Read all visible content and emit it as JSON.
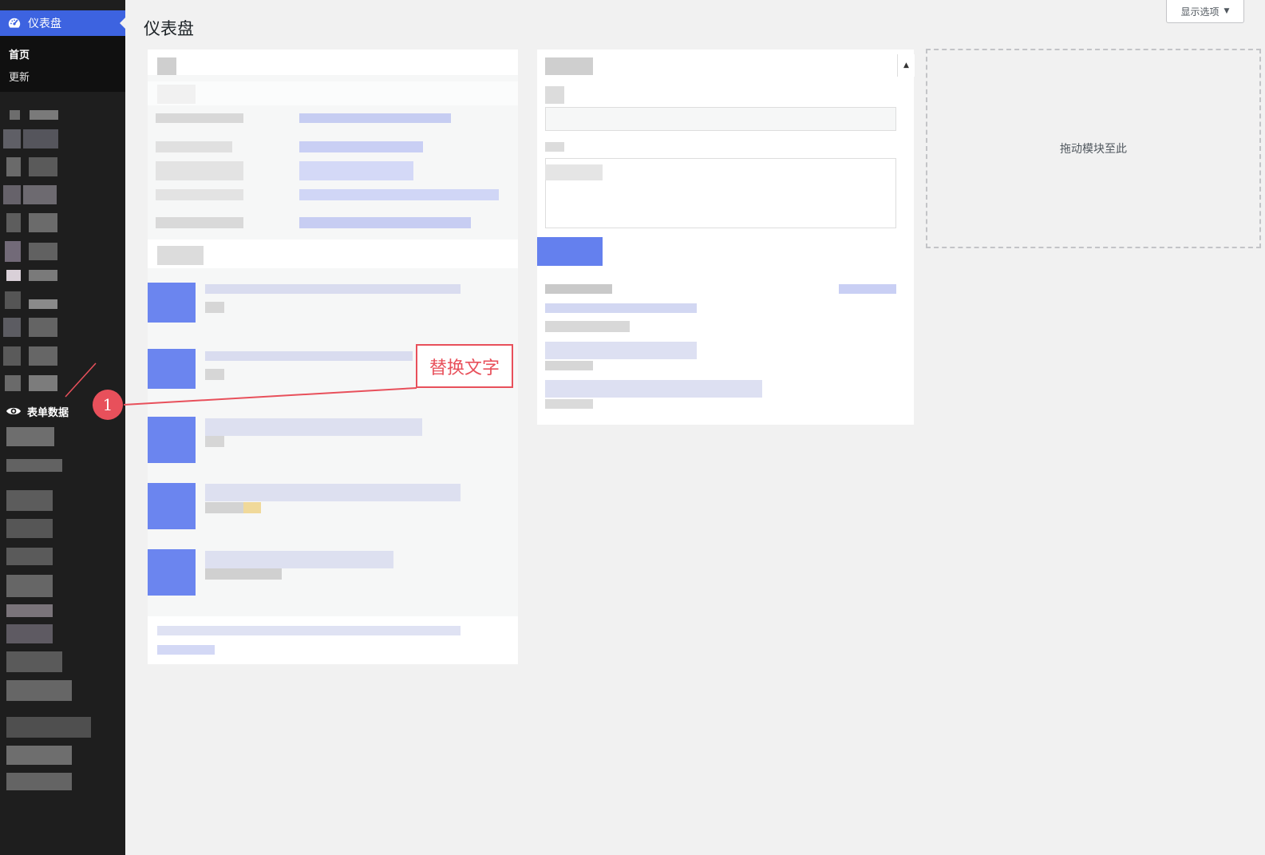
{
  "sidebar": {
    "active_menu": "仪表盘",
    "submenu": [
      "首页",
      "更新"
    ],
    "forms_menu": "表单数据"
  },
  "page": {
    "title": "仪表盘",
    "screen_options": "显示选项",
    "drop_zone_text": "拖动模块至此"
  },
  "annotation": {
    "callout_text": "替换文字",
    "badge_number": "1",
    "color": "#e8505b"
  },
  "colors": {
    "accent": "#3d63e0",
    "sidebar_bg": "#1e1e1e"
  },
  "icons": {
    "active_menu": "dashboard-gauge-icon",
    "forms_menu": "eye-icon",
    "screen_options": "caret-down-icon"
  }
}
